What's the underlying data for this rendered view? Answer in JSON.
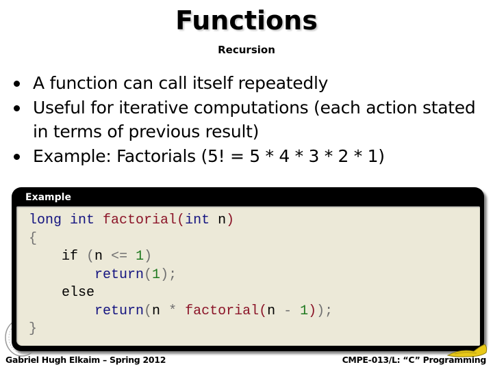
{
  "slide": {
    "title": "Functions",
    "subtitle": "Recursion",
    "bullets": [
      "A function can call itself repeatedly",
      "Useful for iterative computations (each action stated in terms of previous result)",
      "Example: Factorials  (5! = 5 * 4 * 3 * 2 * 1)"
    ],
    "example_label": "Example",
    "code": {
      "line1": {
        "kw1": "long int ",
        "fn": "factorial(",
        "kw2": "int ",
        "pl": "n",
        "fn_close": ")"
      },
      "line2": {
        "op": "{"
      },
      "line3": {
        "indent": "    ",
        "pl1": "if ",
        "op1": "(",
        "pl2": "n ",
        "op2": "<= ",
        "num": "1",
        "op3": ")"
      },
      "line4": {
        "indent": "        ",
        "kw": "return",
        "op1": "(",
        "num": "1",
        "op2": ");"
      },
      "line5": {
        "indent": "    ",
        "pl": "else"
      },
      "line6": {
        "indent": "        ",
        "kw": "return",
        "op1": "(",
        "pl1": "n ",
        "op2": "* ",
        "fn": "factorial(",
        "pl2": "n ",
        "op3": "- ",
        "num": "1",
        "fn_close": ")",
        "op4": ");"
      },
      "line7": {
        "op": "}"
      }
    },
    "footer_left": "Gabriel Hugh Elkaim – Spring 2012",
    "footer_right": "CMPE-013/L: “C” Programming",
    "colors": {
      "keyword": "#141480",
      "function": "#8b1428",
      "number": "#1e781e",
      "operator": "#707070",
      "code_background": "#ece9d8",
      "box_frame": "#000000"
    }
  }
}
